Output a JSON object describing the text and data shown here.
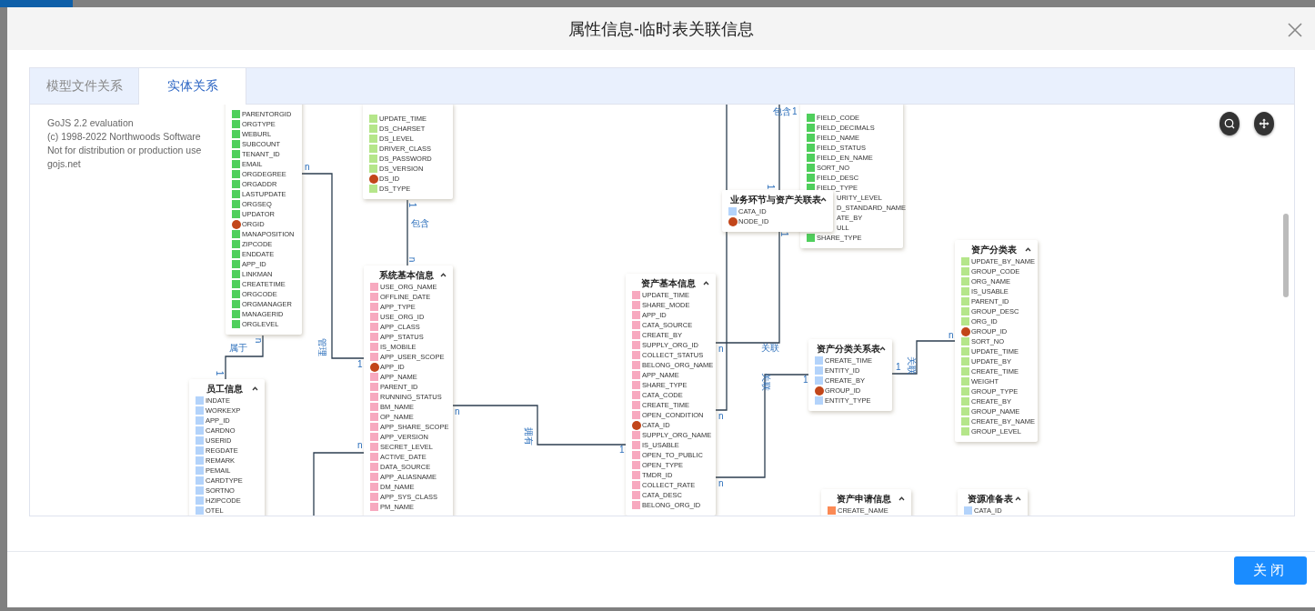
{
  "dialog": {
    "title": "属性信息-临时表关联信息",
    "close_button": "关闭"
  },
  "tabs": [
    {
      "label": "模型文件关系",
      "selected": false
    },
    {
      "label": "实体关系",
      "selected": true
    }
  ],
  "diagram": {
    "notice": [
      "GoJS 2.2 evaluation",
      "(c) 1998-2022 Northwoods Software",
      "Not for distribution or production use",
      "gojs.net"
    ],
    "nodes": [
      {
        "title": "员工信息",
        "color": "#b3d3fb",
        "fields": [
          {
            "name": "INDATE",
            "kind": "field"
          },
          {
            "name": "WORKEXP",
            "kind": "field"
          },
          {
            "name": "APP_ID",
            "kind": "field"
          },
          {
            "name": "CARDNO",
            "kind": "field"
          },
          {
            "name": "USERID",
            "kind": "field"
          },
          {
            "name": "REGDATE",
            "kind": "field"
          },
          {
            "name": "REMARK",
            "kind": "field"
          },
          {
            "name": "PEMAIL",
            "kind": "field"
          },
          {
            "name": "CARDTYPE",
            "kind": "field"
          },
          {
            "name": "SORTNO",
            "kind": "field"
          },
          {
            "name": "HZIPCODE",
            "kind": "field"
          },
          {
            "name": "OTEL",
            "kind": "field"
          }
        ]
      },
      {
        "color": "#4fcf5c",
        "fields": [
          {
            "name": "PARENTORGID",
            "kind": "field"
          },
          {
            "name": "ORGTYPE",
            "kind": "field"
          },
          {
            "name": "WEBURL",
            "kind": "field"
          },
          {
            "name": "SUBCOUNT",
            "kind": "field"
          },
          {
            "name": "TENANT_ID",
            "kind": "field"
          },
          {
            "name": "EMAIL",
            "kind": "field"
          },
          {
            "name": "ORGDEGREE",
            "kind": "field"
          },
          {
            "name": "ORGADDR",
            "kind": "field"
          },
          {
            "name": "LASTUPDATE",
            "kind": "field"
          },
          {
            "name": "ORGSEQ",
            "kind": "field"
          },
          {
            "name": "UPDATOR",
            "kind": "field"
          },
          {
            "name": "ORGID",
            "kind": "key"
          },
          {
            "name": "MANAPOSITION",
            "kind": "field"
          },
          {
            "name": "ZIPCODE",
            "kind": "field"
          },
          {
            "name": "ENDDATE",
            "kind": "field"
          },
          {
            "name": "APP_ID",
            "kind": "field"
          },
          {
            "name": "LINKMAN",
            "kind": "field"
          },
          {
            "name": "CREATETIME",
            "kind": "field"
          },
          {
            "name": "ORGCODE",
            "kind": "field"
          },
          {
            "name": "ORGMANAGER",
            "kind": "field"
          },
          {
            "name": "MANAGERID",
            "kind": "field"
          },
          {
            "name": "ORGLEVEL",
            "kind": "field"
          }
        ]
      },
      {
        "color": "#b5e68a",
        "fields": [
          {
            "name": "UPDATE_TIME",
            "kind": "field"
          },
          {
            "name": "DS_CHARSET",
            "kind": "field"
          },
          {
            "name": "DS_LEVEL",
            "kind": "field"
          },
          {
            "name": "DRIVER_CLASS",
            "kind": "field"
          },
          {
            "name": "DS_PASSWORD",
            "kind": "field"
          },
          {
            "name": "DS_VERSION",
            "kind": "field"
          },
          {
            "name": "DS_ID",
            "kind": "key"
          },
          {
            "name": "DS_TYPE",
            "kind": "field"
          }
        ]
      },
      {
        "title": "系统基本信息",
        "color": "#f7a9bf",
        "fields": [
          {
            "name": "USE_ORG_NAME",
            "kind": "field"
          },
          {
            "name": "OFFLINE_DATE",
            "kind": "field"
          },
          {
            "name": "APP_TYPE",
            "kind": "field"
          },
          {
            "name": "USE_ORG_ID",
            "kind": "field"
          },
          {
            "name": "APP_CLASS",
            "kind": "field"
          },
          {
            "name": "APP_STATUS",
            "kind": "field"
          },
          {
            "name": "IS_MOBILE",
            "kind": "field"
          },
          {
            "name": "APP_USER_SCOPE",
            "kind": "field"
          },
          {
            "name": "APP_ID",
            "kind": "key"
          },
          {
            "name": "APP_NAME",
            "kind": "field"
          },
          {
            "name": "PARENT_ID",
            "kind": "field"
          },
          {
            "name": "RUNNING_STATUS",
            "kind": "field"
          },
          {
            "name": "BM_NAME",
            "kind": "field"
          },
          {
            "name": "OP_NAME",
            "kind": "field"
          },
          {
            "name": "APP_SHARE_SCOPE",
            "kind": "field"
          },
          {
            "name": "APP_VERSION",
            "kind": "field"
          },
          {
            "name": "SECRET_LEVEL",
            "kind": "field"
          },
          {
            "name": "ACTIVE_DATE",
            "kind": "field"
          },
          {
            "name": "DATA_SOURCE",
            "kind": "field"
          },
          {
            "name": "APP_ALIASNAME",
            "kind": "field"
          },
          {
            "name": "DM_NAME",
            "kind": "field"
          },
          {
            "name": "APP_SYS_CLASS",
            "kind": "field"
          },
          {
            "name": "PM_NAME",
            "kind": "field"
          }
        ]
      },
      {
        "title": "资产基本信息",
        "color": "#f7a9bf",
        "fields": [
          {
            "name": "UPDATE_TIME",
            "kind": "field"
          },
          {
            "name": "SHARE_MODE",
            "kind": "field"
          },
          {
            "name": "APP_ID",
            "kind": "field"
          },
          {
            "name": "CATA_SOURCE",
            "kind": "field"
          },
          {
            "name": "CREATE_BY",
            "kind": "field"
          },
          {
            "name": "SUPPLY_ORG_ID",
            "kind": "field"
          },
          {
            "name": "COLLECT_STATUS",
            "kind": "field"
          },
          {
            "name": "BELONG_ORG_NAME",
            "kind": "field"
          },
          {
            "name": "APP_NAME",
            "kind": "field"
          },
          {
            "name": "SHARE_TYPE",
            "kind": "field"
          },
          {
            "name": "CATA_CODE",
            "kind": "field"
          },
          {
            "name": "CREATE_TIME",
            "kind": "field"
          },
          {
            "name": "OPEN_CONDITION",
            "kind": "field"
          },
          {
            "name": "CATA_ID",
            "kind": "key"
          },
          {
            "name": "SUPPLY_ORG_NAME",
            "kind": "field"
          },
          {
            "name": "IS_USABLE",
            "kind": "field"
          },
          {
            "name": "OPEN_TO_PUBLIC",
            "kind": "field"
          },
          {
            "name": "OPEN_TYPE",
            "kind": "field"
          },
          {
            "name": "TMDR_ID",
            "kind": "field"
          },
          {
            "name": "COLLECT_RATE",
            "kind": "field"
          },
          {
            "name": "CATA_DESC",
            "kind": "field"
          },
          {
            "name": "BELONG_ORG_ID",
            "kind": "field"
          }
        ]
      },
      {
        "title": "业务环节与资产关联表",
        "color": "#b3d3fb",
        "fields": [
          {
            "name": "CATA_ID",
            "kind": "field"
          },
          {
            "name": "NODE_ID",
            "kind": "key"
          }
        ]
      },
      {
        "color": "#4fcf5c",
        "fields": [
          {
            "name": "FIELD_CODE",
            "kind": "field"
          },
          {
            "name": "FIELD_DECIMALS",
            "kind": "field"
          },
          {
            "name": "FIELD_NAME",
            "kind": "field"
          },
          {
            "name": "FIELD_STATUS",
            "kind": "field"
          },
          {
            "name": "FIELD_EN_NAME",
            "kind": "field"
          },
          {
            "name": "SORT_NO",
            "kind": "field"
          },
          {
            "name": "FIELD_DESC",
            "kind": "field"
          },
          {
            "name": "FIELD_TYPE",
            "kind": "field"
          },
          {
            "name": "URITY_LEVEL",
            "kind": "clipped"
          },
          {
            "name": "D_STANDARD_NAME",
            "kind": "clipped"
          },
          {
            "name": "ATE_BY",
            "kind": "clipped"
          },
          {
            "name": "ULL",
            "kind": "clipped"
          },
          {
            "name": "SHARE_TYPE",
            "kind": "field"
          }
        ]
      },
      {
        "title": "资产分类关系表",
        "color": "#b3d3fb",
        "fields": [
          {
            "name": "CREATE_TIME",
            "kind": "field"
          },
          {
            "name": "ENTITY_ID",
            "kind": "field"
          },
          {
            "name": "CREATE_BY",
            "kind": "field"
          },
          {
            "name": "GROUP_ID",
            "kind": "key"
          },
          {
            "name": "ENTITY_TYPE",
            "kind": "field"
          }
        ]
      },
      {
        "title": "资产申请信息",
        "color": "#fb8a55",
        "fields": [
          {
            "name": "CREATE_NAME",
            "kind": "field"
          }
        ]
      },
      {
        "title": "资产分类表",
        "color": "#b5e68a",
        "fields": [
          {
            "name": "UPDATE_BY_NAME",
            "kind": "field"
          },
          {
            "name": "GROUP_CODE",
            "kind": "field"
          },
          {
            "name": "ORG_NAME",
            "kind": "field"
          },
          {
            "name": "IS_USABLE",
            "kind": "field"
          },
          {
            "name": "PARENT_ID",
            "kind": "field"
          },
          {
            "name": "GROUP_DESC",
            "kind": "field"
          },
          {
            "name": "ORG_ID",
            "kind": "field"
          },
          {
            "name": "GROUP_ID",
            "kind": "key"
          },
          {
            "name": "SORT_NO",
            "kind": "field"
          },
          {
            "name": "UPDATE_TIME",
            "kind": "field"
          },
          {
            "name": "UPDATE_BY",
            "kind": "field"
          },
          {
            "name": "CREATE_TIME",
            "kind": "field"
          },
          {
            "name": "WEIGHT",
            "kind": "field"
          },
          {
            "name": "GROUP_TYPE",
            "kind": "field"
          },
          {
            "name": "CREATE_BY",
            "kind": "field"
          },
          {
            "name": "GROUP_NAME",
            "kind": "field"
          },
          {
            "name": "CREATE_BY_NAME",
            "kind": "field"
          },
          {
            "name": "GROUP_LEVEL",
            "kind": "field"
          }
        ]
      },
      {
        "title": "资源准备表",
        "color": "#b3d3fb",
        "fields": [
          {
            "name": "CATA_ID",
            "kind": "field"
          }
        ]
      }
    ],
    "links": [
      {
        "labels": [
          "n",
          "管理",
          "1"
        ]
      },
      {
        "labels": [
          "n",
          "属于",
          "1"
        ]
      },
      {
        "labels": [
          "1",
          "包含",
          "n"
        ]
      },
      {
        "labels": [
          "n",
          "拥有",
          "1"
        ]
      },
      {
        "labels": [
          "n"
        ]
      },
      {
        "labels": [
          "n",
          "关联",
          "1",
          "1",
          "包含",
          "1"
        ]
      },
      {
        "labels": [
          "n"
        ]
      },
      {
        "labels": [
          "n",
          "关联",
          "1"
        ]
      },
      {
        "labels": [
          "1",
          "关联",
          "n"
        ]
      }
    ]
  }
}
